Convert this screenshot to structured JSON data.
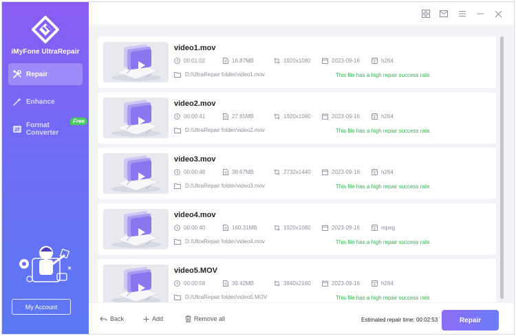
{
  "app": {
    "name": "iMyFone UltraRepair"
  },
  "sidebar": {
    "items": [
      {
        "label": "Repair",
        "icon": "repair-tools-icon",
        "active": true
      },
      {
        "label": "Enhance",
        "icon": "magic-wand-icon",
        "active": false
      },
      {
        "label": "Format Converter",
        "icon": "convert-icon",
        "active": false,
        "badge": "Free"
      }
    ],
    "account_button": "My Account"
  },
  "titlebar": {
    "icons": [
      "grid-icon",
      "mail-icon",
      "menu-icon",
      "minimize-icon",
      "close-icon"
    ]
  },
  "files": [
    {
      "name": "video1.mov",
      "duration": "00:01:02",
      "size": "16.87MB",
      "resolution": "1920x1080",
      "date": "2023-09-16",
      "codec": "h264",
      "path": "D:/UltraRepair folder/video1.mov",
      "status": "This file has a high repair success rate."
    },
    {
      "name": "video2.mov",
      "duration": "00:00:41",
      "size": "27.65MB",
      "resolution": "1920x1080",
      "date": "2023-09-16",
      "codec": "h264",
      "path": "D:/UltraRepair folder/video2.mov",
      "status": "This file has a high repair success rate."
    },
    {
      "name": "video3.mov",
      "duration": "00:00:48",
      "size": "38.67MB",
      "resolution": "2732x1440",
      "date": "2023-09-16",
      "codec": "h264",
      "path": "D:/UltraRepair folder/video3.mov",
      "status": "This file has a high repair success rate."
    },
    {
      "name": "video4.mov",
      "duration": "00:00:40",
      "size": "160.31MB",
      "resolution": "1920x1080",
      "date": "2023-09-16",
      "codec": "mpeg",
      "path": "D:/UltraRepair folder/video4.mov",
      "status": "This file has a high repair success rate."
    },
    {
      "name": "video5.MOV",
      "duration": "00:00:58",
      "size": "39.42MB",
      "resolution": "3840x2160",
      "date": "2023-09-16",
      "codec": "h264",
      "path": "D:/UltraRepair folder/video5.MOV",
      "status": "This file has a high repair success rate."
    }
  ],
  "bottom": {
    "back": "Back",
    "add": "Add",
    "remove_all": "Remove all",
    "estimated": "Estimated repair time: 00:02:53",
    "repair": "Repair"
  },
  "colors": {
    "accent": "#7b6cf5",
    "success": "#2fb24d"
  }
}
